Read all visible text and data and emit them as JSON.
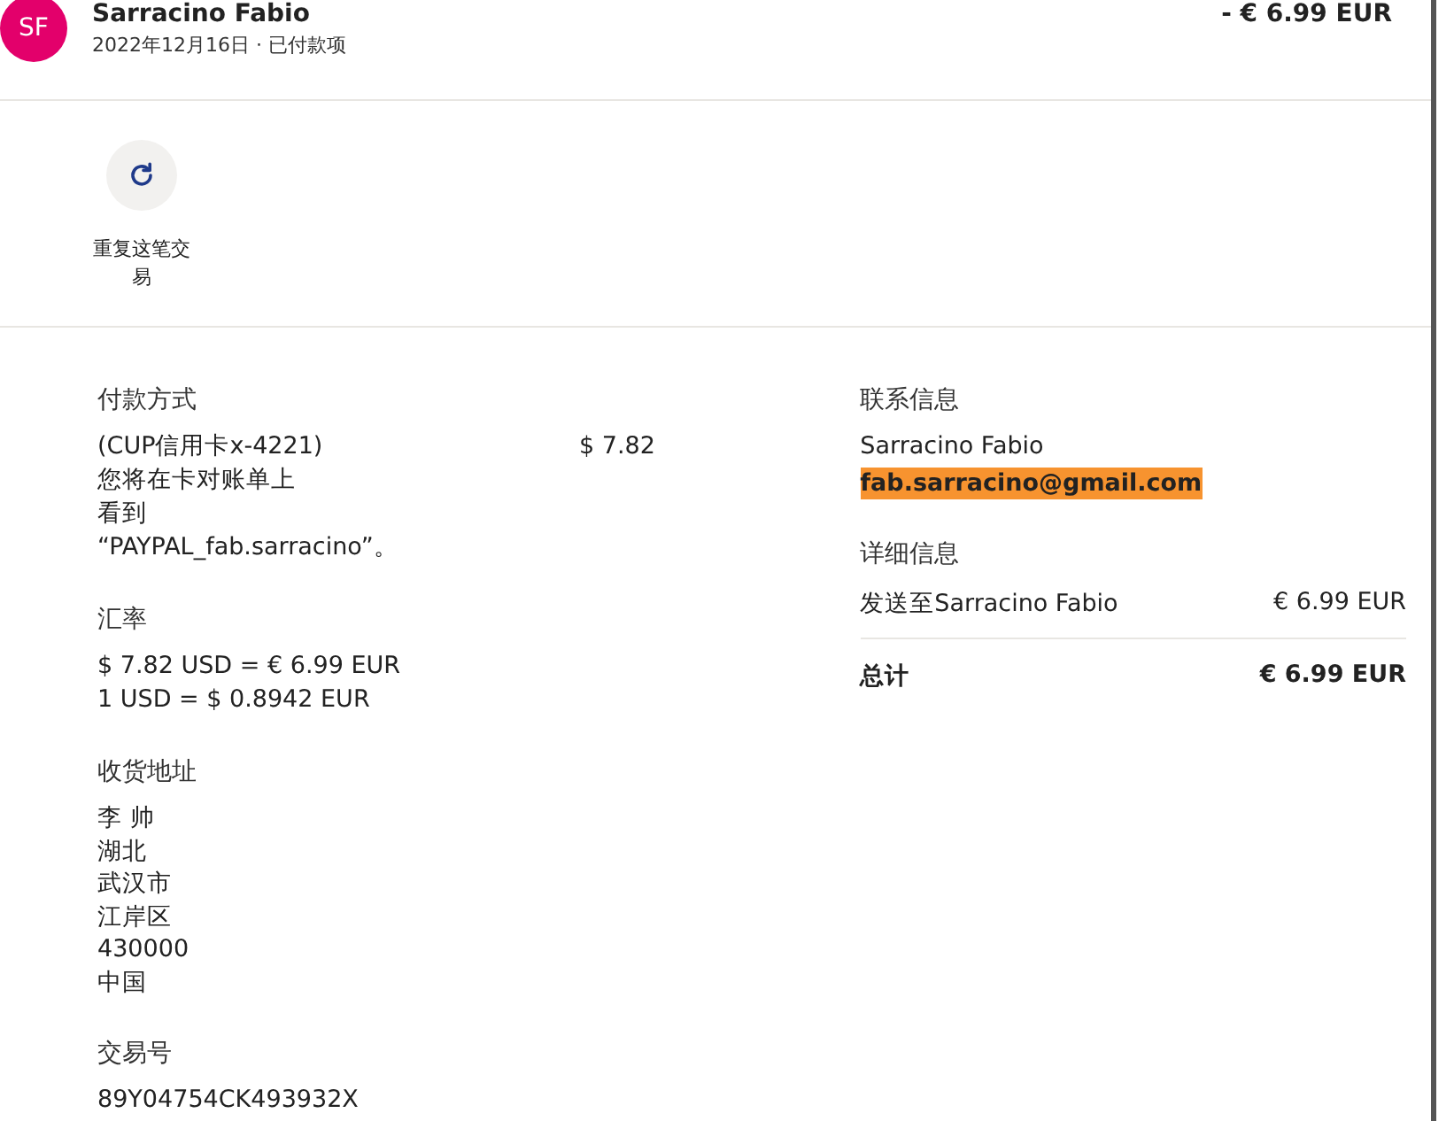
{
  "header": {
    "avatar": "SF",
    "name": "Sarracino Fabio",
    "date": "2022年12月16日",
    "separator": "·",
    "status": "已付款项",
    "amount": "- € 6.99 EUR"
  },
  "actions": [
    {
      "label": "重复这笔交易"
    }
  ],
  "payment": {
    "title": "付款方式",
    "lines": [
      "(CUP信用卡x-4221)",
      "您将在卡对账单上",
      "看到",
      "“PAYPAL_fab.sarracino”。"
    ],
    "amount": "$ 7.82"
  },
  "exchange": {
    "title": "汇率",
    "lines": [
      "$ 7.82 USD = € 6.99 EUR",
      "1 USD = $ 0.8942 EUR"
    ]
  },
  "shipping": {
    "title": "收货地址",
    "lines": [
      "李 帅",
      "湖北",
      "武汉市",
      "江岸区",
      "430000",
      "中国"
    ]
  },
  "transaction": {
    "title": "交易号",
    "id": "89Y04754CK493932X"
  },
  "contact": {
    "title": "联系信息",
    "name": "Sarracino Fabio",
    "email": "fab.sarracino@gmail.com",
    "highlighted": true
  },
  "details": {
    "title": "详细信息",
    "rows": [
      {
        "label": "发送至Sarracino Fabio",
        "amount": "€ 6.99 EUR",
        "kind": "item"
      },
      {
        "label": "总计",
        "amount": "€ 6.99 EUR",
        "kind": "total"
      }
    ]
  }
}
